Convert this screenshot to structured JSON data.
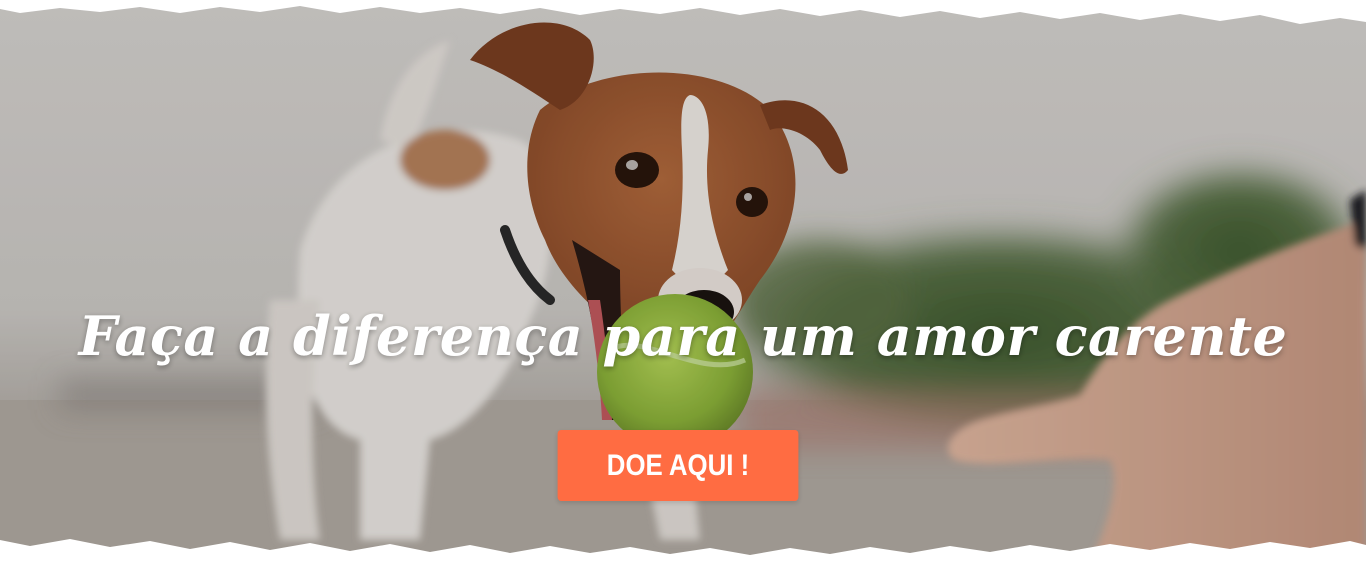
{
  "hero": {
    "image_subject": "dog-with-tennis-ball",
    "headline": "Faça a diferença para um amor carente",
    "cta_label": "DOE AQUI !"
  },
  "colors": {
    "cta_background": "#ff6c42",
    "headline_text": "#ffffff",
    "torn_edge": "#ffffff"
  }
}
